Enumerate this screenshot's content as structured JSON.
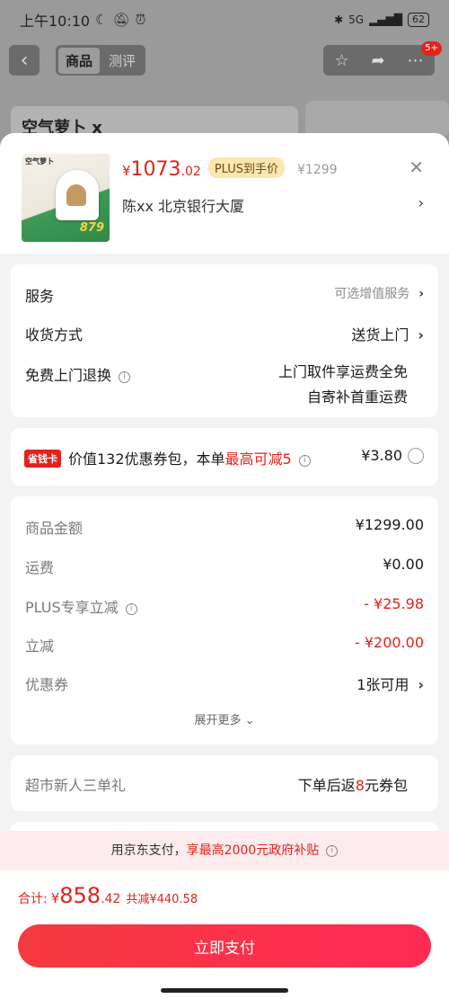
{
  "status_bar": {
    "time": "上午10:10",
    "network": "5G",
    "battery": "62"
  },
  "nav": {
    "back": "‹",
    "tabs": [
      "商品",
      "测评"
    ],
    "badge": "5+"
  },
  "background": {
    "product_text": "空气萝卜 x"
  },
  "product": {
    "image_brand": "空气萝卜",
    "image_price": "879",
    "currency": "¥",
    "price_int": "1073",
    "price_dec": ".02",
    "plus_tag": "PLUS到手价",
    "original_price": "¥1299",
    "address": "陈xx  北京银行大厦"
  },
  "services": {
    "service_label": "服务",
    "service_value": "可选增值服务",
    "delivery_label": "收货方式",
    "delivery_value": "送货上门",
    "return_label": "免费上门退换",
    "return_line1": "上门取件享运费全免",
    "return_line2": "自寄补首重运费"
  },
  "saving_card": {
    "badge": "省钱卡",
    "text_prefix": "价值132优惠券包，本单",
    "text_highlight": "最高可减5",
    "price": "¥3.80"
  },
  "amounts": {
    "goods_label": "商品金额",
    "goods_value": "¥1299.00",
    "shipping_label": "运费",
    "shipping_value": "¥0.00",
    "plus_label": "PLUS专享立减",
    "plus_value": "- ¥25.98",
    "discount_label": "立减",
    "discount_value": "- ¥200.00",
    "coupon_label": "优惠券",
    "coupon_value": "1张可用",
    "expand": "展开更多 ⌄"
  },
  "gift": {
    "label": "超市新人三单礼",
    "value_prefix": "下单后返",
    "value_highlight": "8",
    "value_suffix": "元券包"
  },
  "payment": {
    "banner_prefix": "用京东支付，",
    "banner_highlight": "享最高2000元政府补贴",
    "total_label": "合计:",
    "total_currency": "¥",
    "total_int": "858",
    "total_dec": ".42",
    "total_saved": "共减¥440.58",
    "pay_button": "立即支付"
  },
  "colors": {
    "accent_red": "#e2231a",
    "button_gradient_start": "#f53a3f",
    "button_gradient_end": "#ff2a55",
    "plus_tag_bg": "#fbe7b0"
  }
}
